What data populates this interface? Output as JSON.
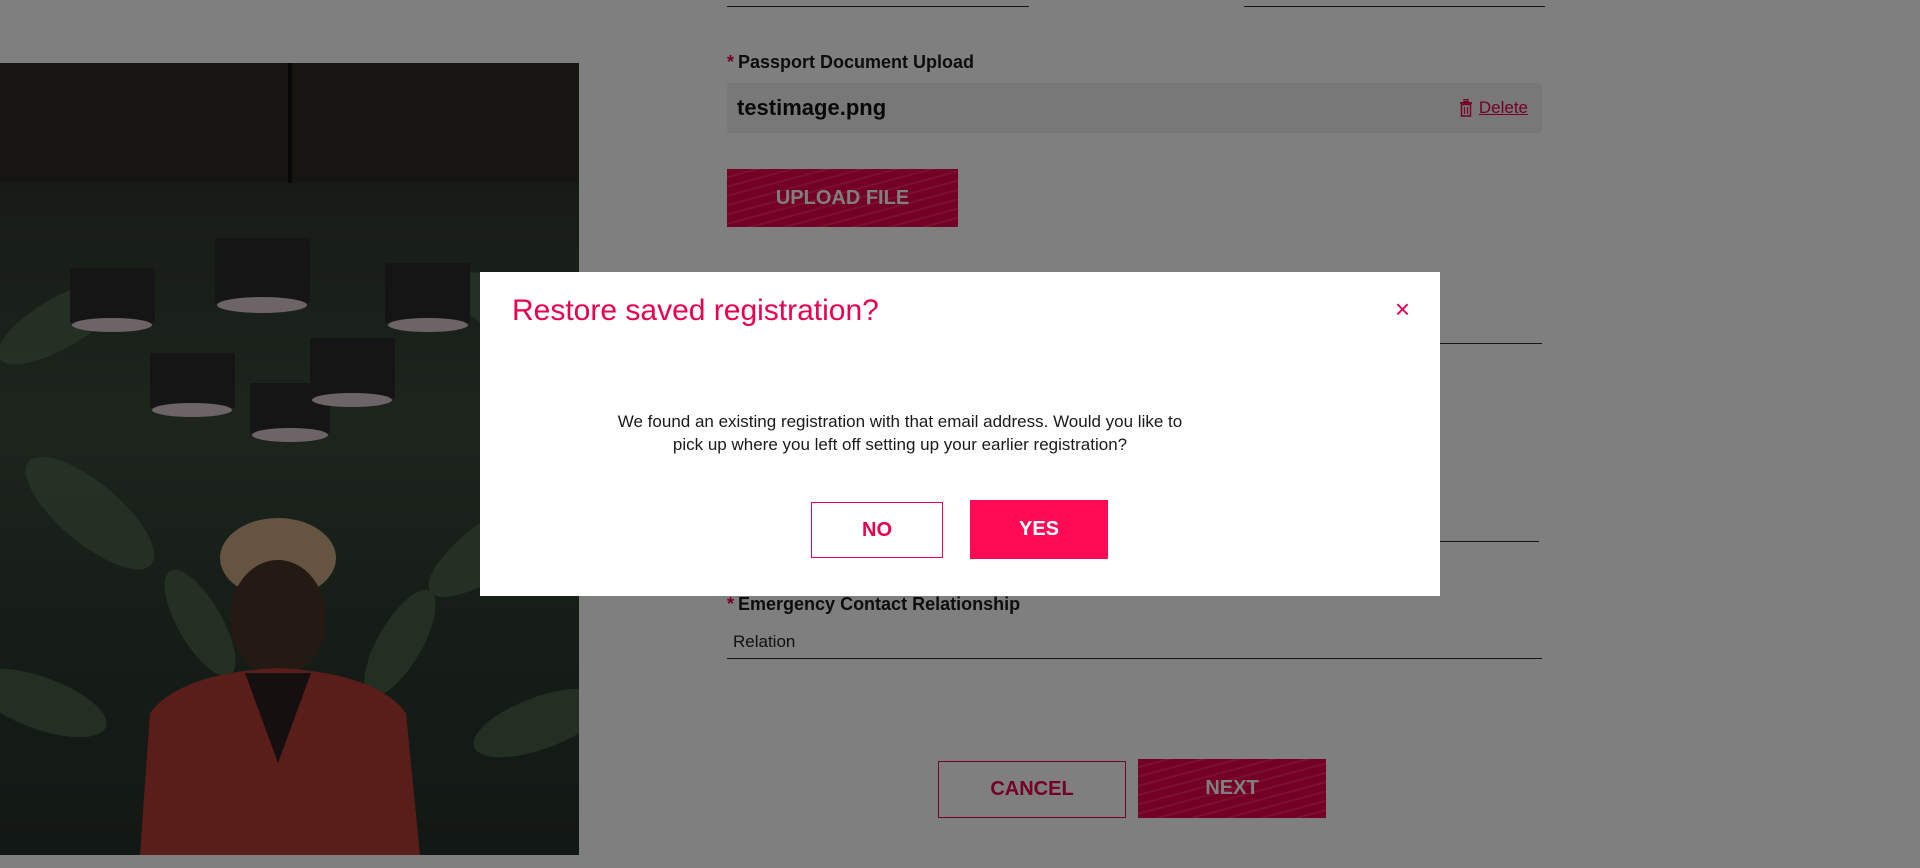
{
  "form": {
    "passport_label": "Passport Document Upload",
    "required_marker": "*",
    "file_name": "testimage.png",
    "delete_label": "Delete",
    "upload_label": "UPLOAD FILE",
    "relationship_label": "Emergency Contact Relationship",
    "relationship_value": "Relation",
    "cancel_label": "CANCEL",
    "next_label": "NEXT"
  },
  "modal": {
    "title": "Restore saved registration?",
    "close_glyph": "×",
    "message": "We found an existing registration with that email address. Would you like to pick up where you left off setting up your earlier registration?",
    "no_label": "NO",
    "yes_label": "YES"
  },
  "colors": {
    "accent": "#e8004d",
    "overlay": "rgba(0,0,0,0.5)"
  }
}
